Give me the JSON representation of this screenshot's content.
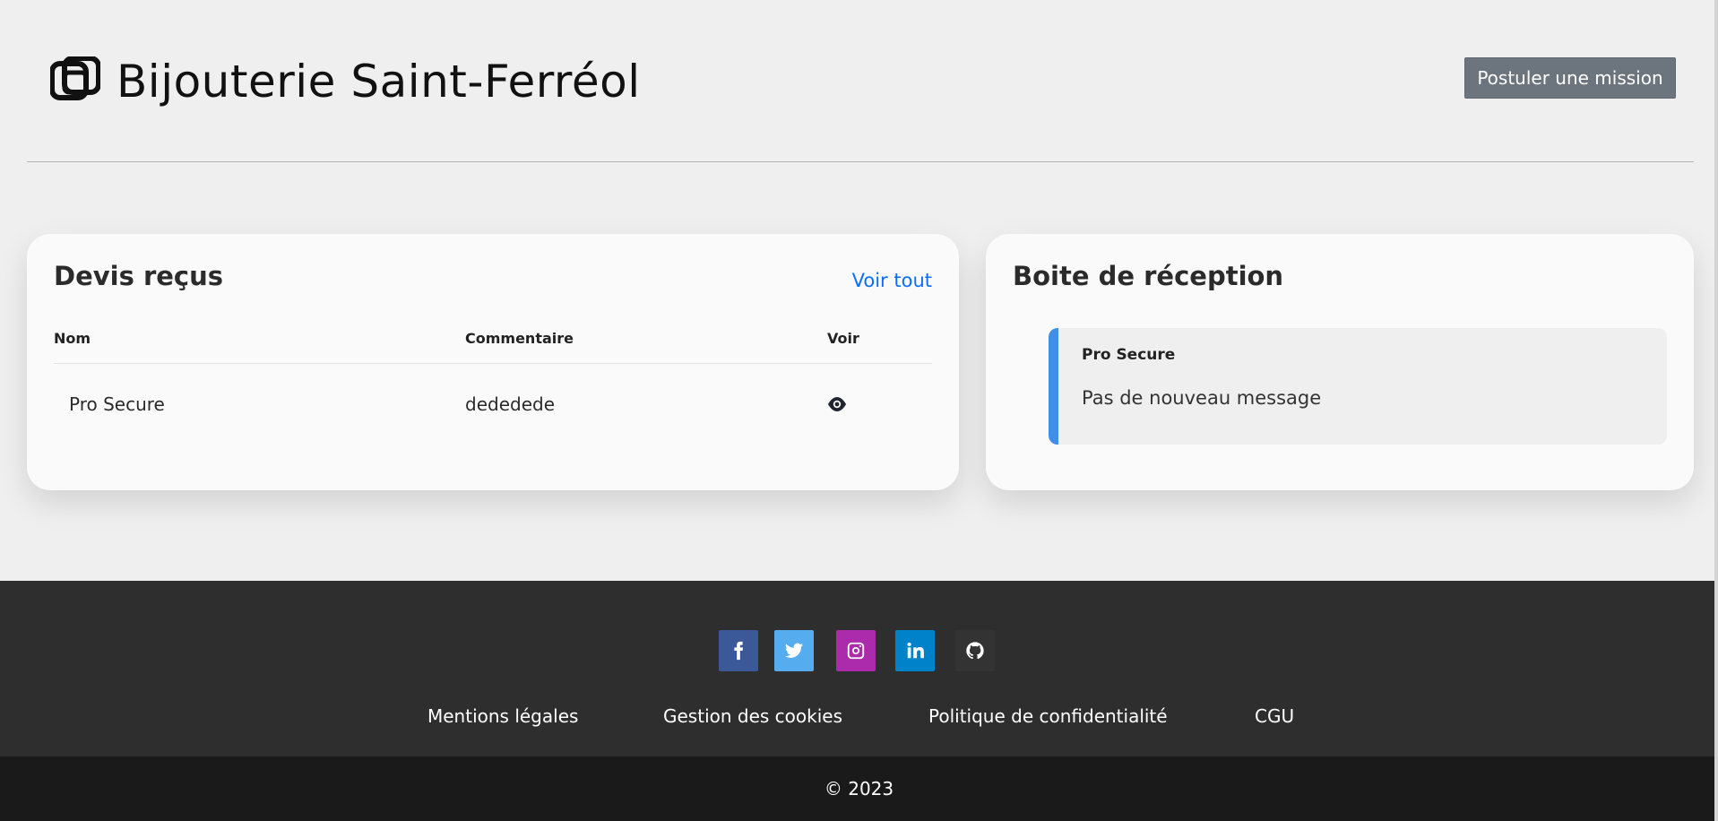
{
  "header": {
    "brand_icon": "interlocking-squares-logo-icon",
    "title": "Bijouterie Saint-Ferréol",
    "apply_button": "Postuler une mission"
  },
  "quotes_card": {
    "title": "Devis reçus",
    "see_all": "Voir tout",
    "columns": [
      "Nom",
      "Commentaire",
      "Voir"
    ],
    "rows": [
      {
        "name": "Pro Secure",
        "comment": "dededede",
        "view_icon": "eye-icon"
      }
    ]
  },
  "inbox_card": {
    "title": "Boite de réception",
    "messages": [
      {
        "from": "Pro Secure",
        "text": "Pas de nouveau message",
        "accent": "#3f8ee8"
      }
    ]
  },
  "footer": {
    "social": [
      {
        "name": "facebook-icon",
        "color": "#3b5998"
      },
      {
        "name": "twitter-icon",
        "color": "#55acee"
      },
      {
        "name": "instagram-icon",
        "color": "#ac2bac"
      },
      {
        "name": "linkedin-icon",
        "color": "#0082ca"
      },
      {
        "name": "github-icon",
        "color": "#333333"
      }
    ],
    "links": [
      "Mentions légales",
      "Gestion des cookies",
      "Politique de confidentialité",
      "CGU"
    ],
    "copyright": "© 2023"
  }
}
